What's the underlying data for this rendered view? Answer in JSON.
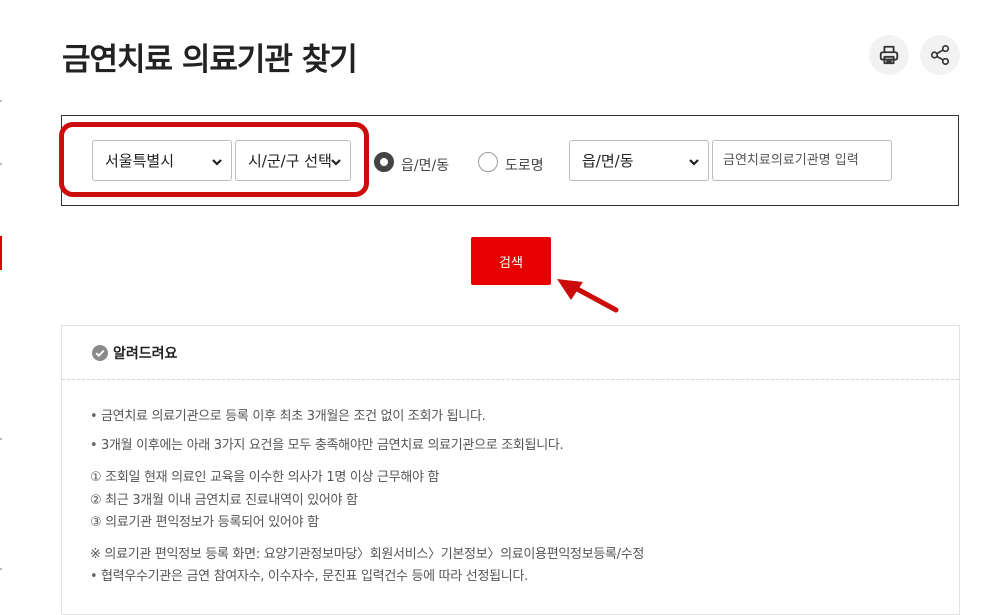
{
  "page": {
    "title": "금연치료 의료기관 찾기"
  },
  "toolbar": {
    "print_icon": "printer-icon",
    "share_icon": "share-icon"
  },
  "search": {
    "city_select": {
      "selected": "서울특별시"
    },
    "district_select": {
      "selected": "시/군/구 선택"
    },
    "address_type": {
      "options": [
        "읍/면/동",
        "도로명"
      ],
      "selected": "읍/면/동"
    },
    "dong_select": {
      "selected": "읍/면/동"
    },
    "name_input": {
      "value": "",
      "placeholder": "금연치료의료기관명 입력"
    },
    "submit_label": "검색"
  },
  "notice": {
    "title": "알려드려요",
    "bullets": [
      "금연치료 의료기관으로 등록 이후 최초 3개월은 조건 없이 조회가 됩니다.",
      "3개월 이후에는 아래 3가지 요건을 모두 충족해야만 금연치료 의료기관으로 조회됩니다."
    ],
    "requirements": [
      "① 조회일 현재 의료인 교육을 이수한 의사가 1명 이상 근무해야 함",
      "② 최근 3개월 이내 금연치료 진료내역이 있어야 함",
      "③ 의료기관 편익정보가 등록되어 있어야 함"
    ],
    "note": "※ 의료기관 편익정보 등록 화면: 요양기관정보마당〉회원서비스〉기본정보〉의료이용편익정보등록/수정",
    "last_bullet": "협력우수기관은 금연 참여자수, 이수자수, 문진표 입력건수 등에 따라 선정됩니다."
  },
  "colors": {
    "accent_red": "#e60000",
    "highlight_red": "#cc0b0b"
  }
}
